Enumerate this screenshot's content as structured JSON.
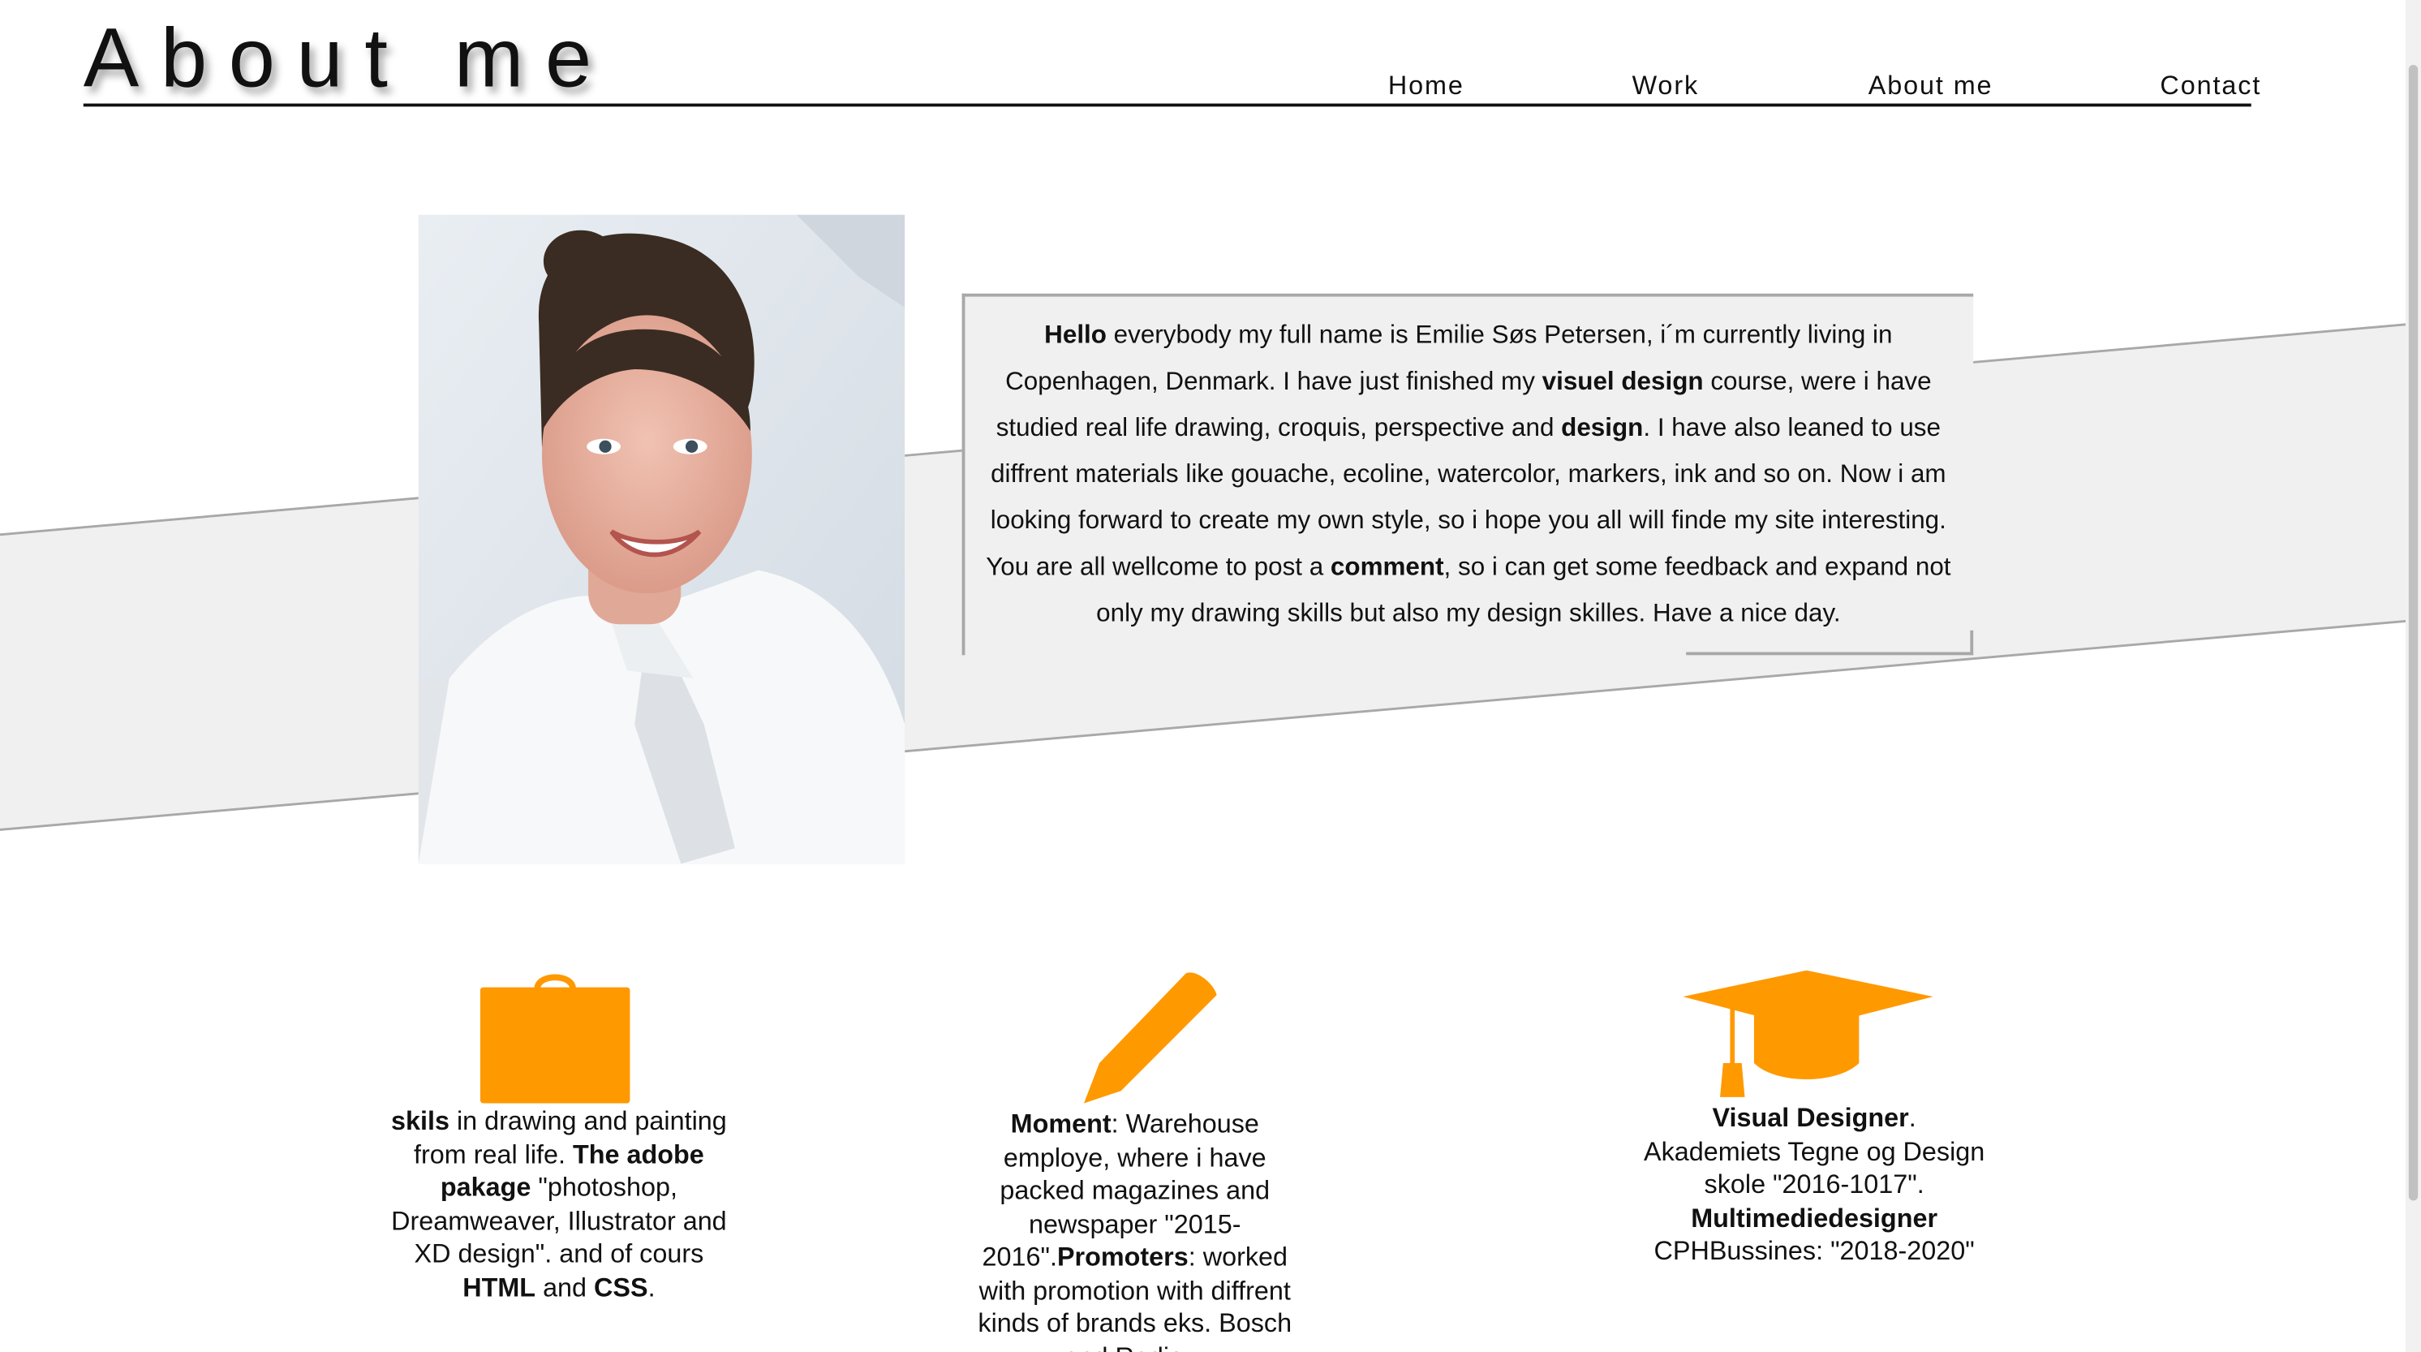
{
  "header": {
    "title": "About me",
    "nav": [
      "Home",
      "Work",
      "About me",
      "Contact"
    ]
  },
  "intro": {
    "segments": [
      {
        "bold": true,
        "text": "Hello"
      },
      {
        "bold": false,
        "text": " everybody my full name is Emilie Søs Petersen, i´m currently living in Copenhagen, Denmark. I have just finished my "
      },
      {
        "bold": true,
        "text": "visuel design"
      },
      {
        "bold": false,
        "text": " course, were i have studied real life drawing, croquis, perspective and "
      },
      {
        "bold": true,
        "text": "design"
      },
      {
        "bold": false,
        "text": ". I have also leaned to use diffrent materials like gouache, ecoline, watercolor, markers, ink and so on. Now i am looking forward to create my own style, so i hope you all will finde my site interesting. You are all wellcome to post a "
      },
      {
        "bold": true,
        "text": "comment"
      },
      {
        "bold": false,
        "text": ", so i can get some feedback and expand not only my drawing skills but also my design skilles. Have a nice day."
      }
    ]
  },
  "features": [
    {
      "icon": "briefcase-icon",
      "segments": [
        {
          "bold": true,
          "text": "skils"
        },
        {
          "bold": false,
          "text": " in drawing and painting from real life. "
        },
        {
          "bold": true,
          "text": "The adobe pakage"
        },
        {
          "bold": false,
          "text": " \"photoshop, Dreamweaver, Illustrator and XD design\". and of cours "
        },
        {
          "bold": true,
          "text": "HTML"
        },
        {
          "bold": false,
          "text": " and "
        },
        {
          "bold": true,
          "text": "CSS"
        },
        {
          "bold": false,
          "text": "."
        }
      ]
    },
    {
      "icon": "pencil-icon",
      "segments": [
        {
          "bold": true,
          "text": "Moment"
        },
        {
          "bold": false,
          "text": ": Warehouse employe, where i have packed magazines and newspaper \"2015-2016\"."
        },
        {
          "bold": true,
          "text": "Promoters"
        },
        {
          "bold": false,
          "text": ": worked with promotion with diffrent kinds of brands eks. Bosch and Radio..."
        }
      ]
    },
    {
      "icon": "graduation-cap-icon",
      "segments": [
        {
          "bold": true,
          "text": "Visual Designer"
        },
        {
          "bold": false,
          "text": ". Akademiets Tegne og Design skole \"2016-1017\". "
        },
        {
          "bold": true,
          "text": "Multimediedesigner"
        },
        {
          "bold": false,
          "text": " CPHBussines: \"2018-2020\""
        }
      ]
    }
  ],
  "colors": {
    "accent": "#ff9900",
    "band": "#f0f0f0",
    "band_edge": "#a8a8a8",
    "text": "#111111"
  }
}
